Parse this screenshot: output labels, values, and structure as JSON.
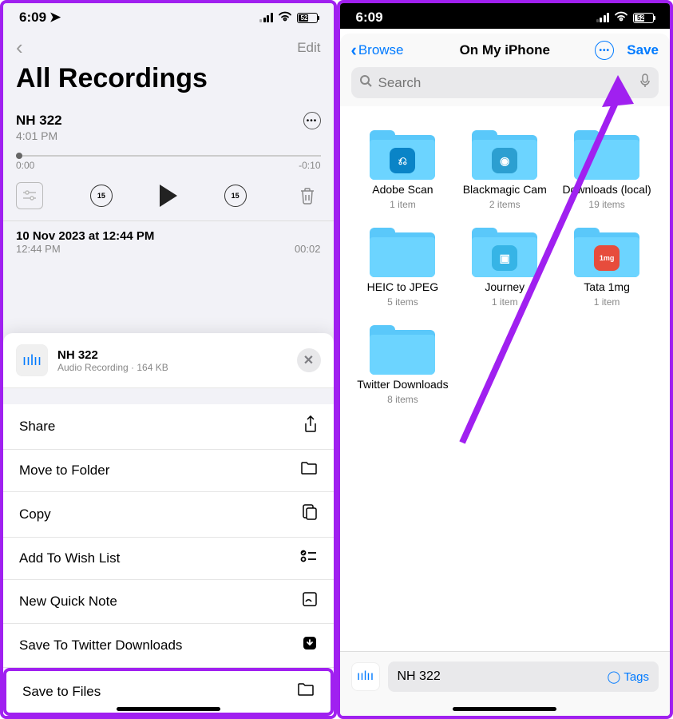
{
  "status": {
    "time": "6:09",
    "battery": "52"
  },
  "left": {
    "editLabel": "Edit",
    "pageTitle": "All Recordings",
    "recording1": {
      "name": "NH 322",
      "time": "4:01 PM",
      "startTime": "0:00",
      "endTime": "-0:10",
      "skipSeconds": "15"
    },
    "recording2": {
      "title": "10 Nov 2023 at 12:44 PM",
      "time": "12:44 PM",
      "duration": "00:02"
    },
    "sheet": {
      "title": "NH 322",
      "subtitle": "Audio Recording · 164 KB",
      "actions": {
        "share": "Share",
        "moveToFolder": "Move to Folder",
        "copy": "Copy",
        "addWishlist": "Add To Wish List",
        "quickNote": "New Quick Note",
        "saveTwitter": "Save To Twitter Downloads",
        "saveFiles": "Save to Files"
      }
    }
  },
  "right": {
    "browseLabel": "Browse",
    "title": "On My iPhone",
    "saveLabel": "Save",
    "searchPlaceholder": "Search",
    "folders": [
      {
        "name": "Adobe Scan",
        "meta": "1 item",
        "appColor": "#0a84c7",
        "appLabel": "⎌"
      },
      {
        "name": "Blackmagic Cam",
        "meta": "2 items",
        "appColor": "#2c9fd1",
        "appLabel": "◉"
      },
      {
        "name": "Downloads (local)",
        "meta": "19 items",
        "appColor": "",
        "appLabel": ""
      },
      {
        "name": "HEIC to JPEG",
        "meta": "5 items",
        "appColor": "",
        "appLabel": ""
      },
      {
        "name": "Journey",
        "meta": "1 item",
        "appColor": "#36b4e6",
        "appLabel": "▣"
      },
      {
        "name": "Tata 1mg",
        "meta": "1 item",
        "appColor": "#e74c3c",
        "appLabel": "1mg"
      },
      {
        "name": "Twitter Downloads",
        "meta": "8 items",
        "appColor": "",
        "appLabel": ""
      }
    ],
    "filename": "NH 322",
    "tagsLabel": "Tags"
  }
}
